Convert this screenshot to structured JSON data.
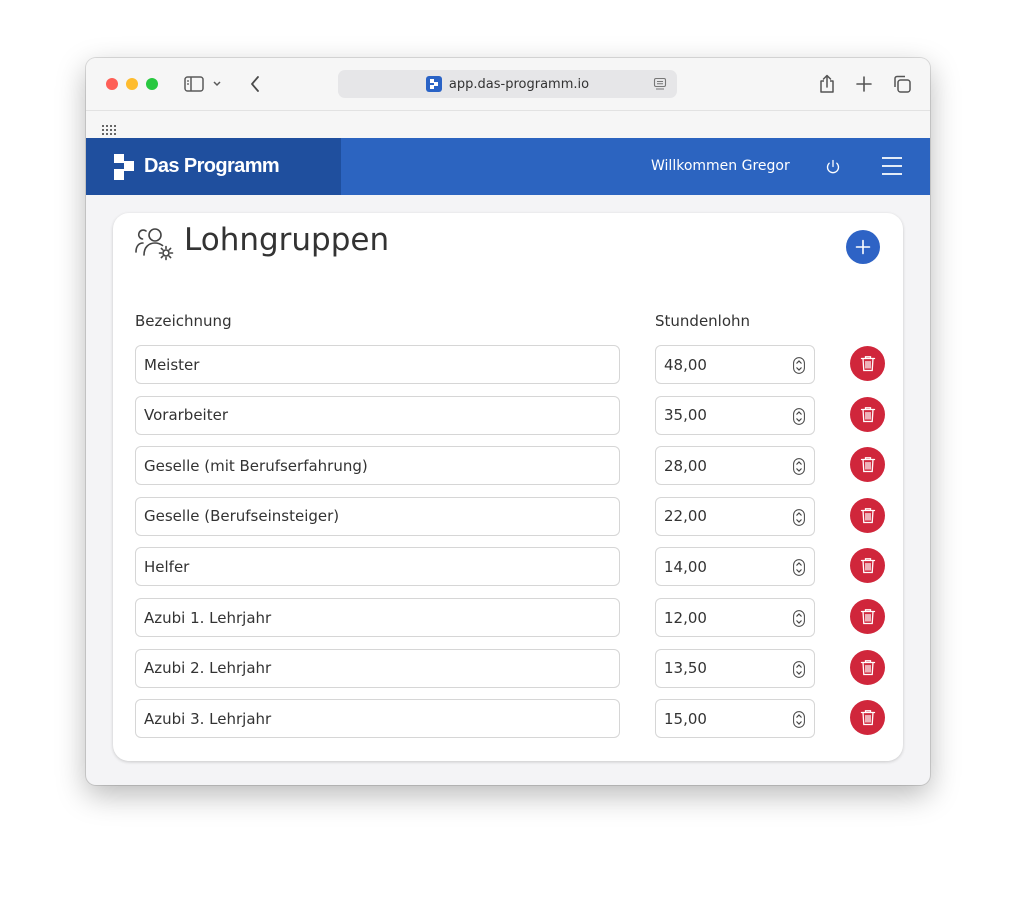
{
  "browser": {
    "url": "app.das-programm.io"
  },
  "app": {
    "brand": "Das Programm",
    "welcome": "Willkommen Gregor"
  },
  "page": {
    "title": "Lohngruppen",
    "columns": {
      "name": "Bezeichnung",
      "rate": "Stundenlohn"
    },
    "rows": [
      {
        "name": "Meister",
        "rate": "48,00"
      },
      {
        "name": "Vorarbeiter",
        "rate": "35,00"
      },
      {
        "name": "Geselle (mit Berufserfahrung)",
        "rate": "28,00"
      },
      {
        "name": "Geselle (Berufseinsteiger)",
        "rate": "22,00"
      },
      {
        "name": "Helfer",
        "rate": "14,00"
      },
      {
        "name": "Azubi 1. Lehrjahr",
        "rate": "12,00"
      },
      {
        "name": "Azubi 2. Lehrjahr",
        "rate": "13,50"
      },
      {
        "name": "Azubi 3. Lehrjahr",
        "rate": "15,00"
      }
    ]
  },
  "colors": {
    "appbar": "#2c64c0",
    "brand_bg": "#1f4f9e",
    "add_button": "#2e63c5",
    "delete_button": "#d0263b"
  },
  "icons": {
    "add": "plus-icon",
    "delete": "trash-icon",
    "title": "users-gear-icon",
    "power": "power-icon",
    "menu": "hamburger-icon"
  }
}
